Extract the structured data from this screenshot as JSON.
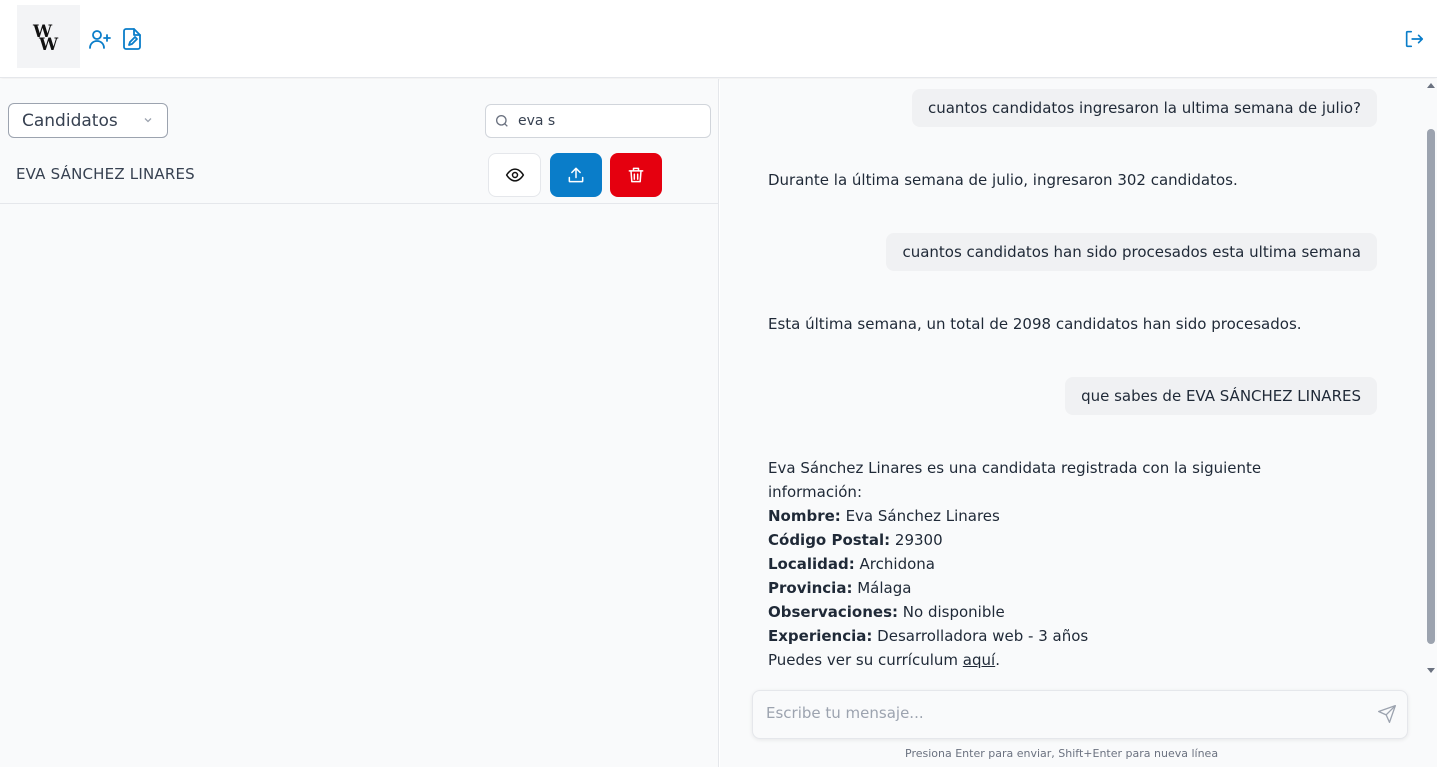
{
  "header": {
    "logo_text": "WW"
  },
  "filter": {
    "selected": "Candidatos"
  },
  "search": {
    "value": "eva s"
  },
  "candidates": [
    {
      "name": "EVA SÁNCHEZ LINARES"
    }
  ],
  "chat": {
    "messages": [
      {
        "role": "user",
        "text": "cuantos candidatos ingresaron la ultima semana de julio?"
      },
      {
        "role": "assistant",
        "text": "Durante la última semana de julio, ingresaron 302 candidatos."
      },
      {
        "role": "user",
        "text": "cuantos candidatos han sido procesados esta ultima semana"
      },
      {
        "role": "assistant",
        "text": "Esta última semana, un total de 2098 candidatos han sido procesados."
      },
      {
        "role": "user",
        "text": "que sabes de EVA SÁNCHEZ LINARES"
      }
    ],
    "profile": {
      "intro": "Eva Sánchez Linares es una candidata registrada con la siguiente información:",
      "fields": [
        {
          "label": "Nombre:",
          "value": "Eva Sánchez Linares"
        },
        {
          "label": "Código Postal:",
          "value": "29300"
        },
        {
          "label": "Localidad:",
          "value": "Archidona"
        },
        {
          "label": "Provincia:",
          "value": "Málaga"
        },
        {
          "label": "Observaciones:",
          "value": "No disponible"
        },
        {
          "label": "Experiencia:",
          "value": "Desarrolladora web - 3 años"
        }
      ],
      "cv_text": "Puedes ver su currículum",
      "cv_link": "aquí",
      "cv_end": "."
    },
    "composer_placeholder": "Escribe tu mensaje...",
    "hint": "Presiona Enter para enviar, Shift+Enter para nueva línea"
  },
  "colors": {
    "accent": "#0a7dc9",
    "danger": "#e5000f"
  }
}
